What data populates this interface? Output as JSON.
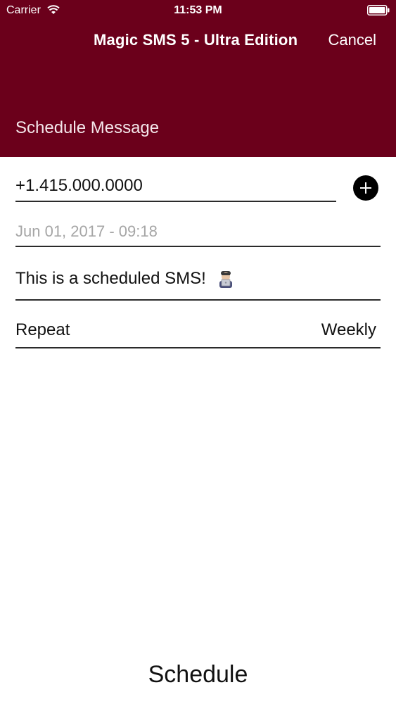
{
  "status_bar": {
    "carrier": "Carrier",
    "time": "11:53 PM"
  },
  "nav": {
    "title": "Magic SMS 5 - Ultra Edition",
    "cancel_label": "Cancel"
  },
  "section": {
    "title": "Schedule Message"
  },
  "form": {
    "phone": "+1.415.000.0000",
    "date": "Jun 01, 2017 - 09:18",
    "message": "This is a scheduled SMS!",
    "message_emoji": "technologist-icon",
    "repeat_label": "Repeat",
    "repeat_value": "Weekly"
  },
  "actions": {
    "schedule_label": "Schedule",
    "add_contact_icon": "plus-icon"
  },
  "colors": {
    "header_bg": "#6b001b",
    "text": "#111111",
    "placeholder": "#a6a6a6"
  }
}
